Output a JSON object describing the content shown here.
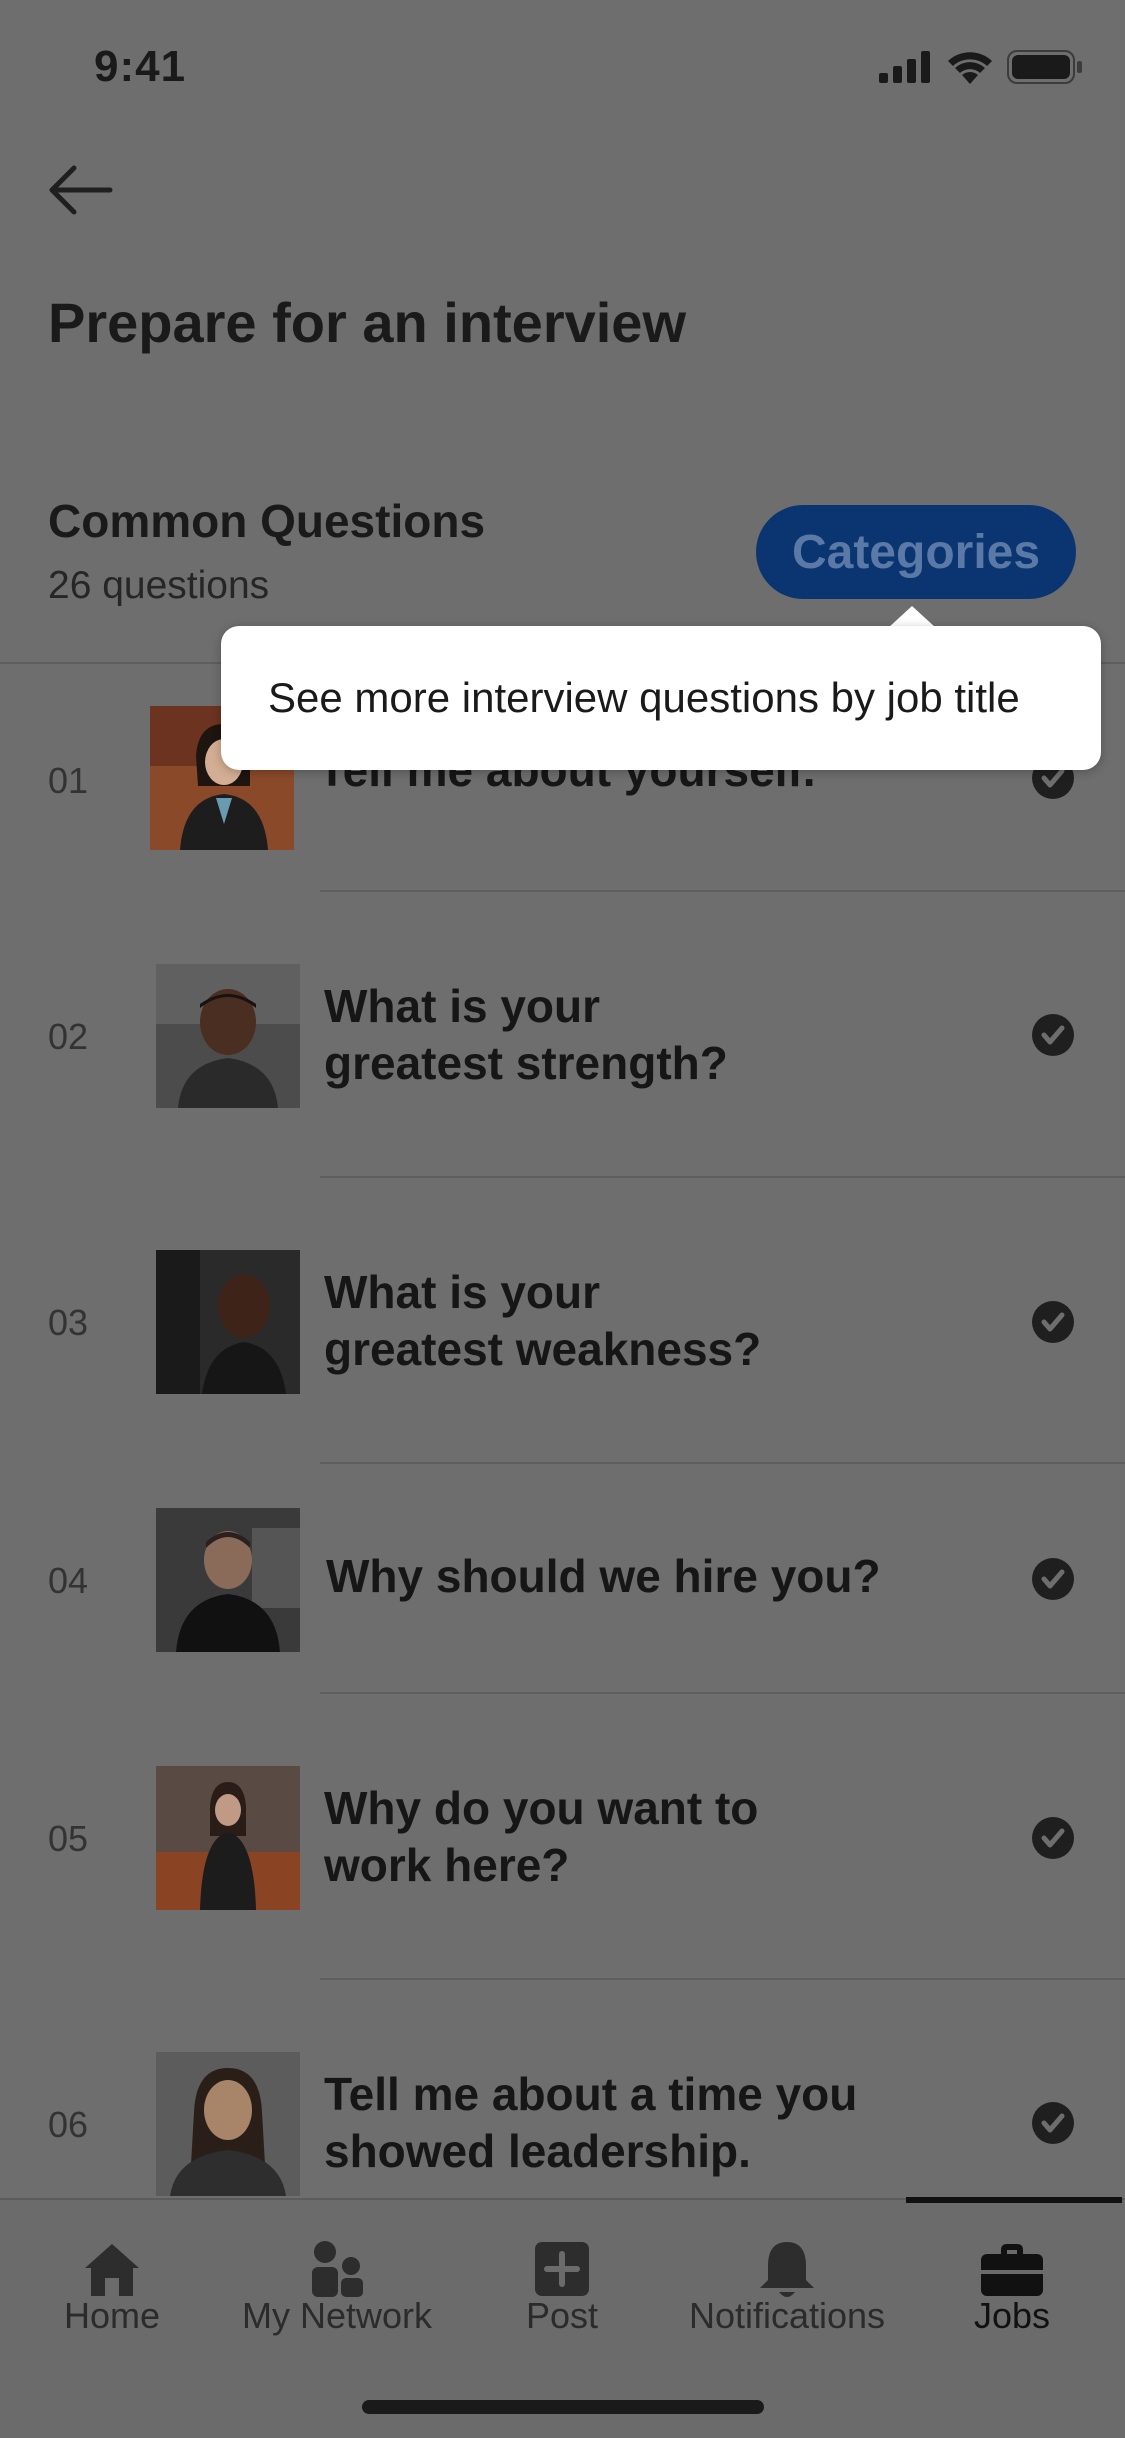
{
  "status_bar": {
    "time": "9:41"
  },
  "header": {
    "title": "Prepare for an interview"
  },
  "section": {
    "title": "Common Questions",
    "subtitle": "26 questions",
    "categories_label": "Categories"
  },
  "tooltip": {
    "text": "See more interview questions by job title"
  },
  "questions": [
    {
      "number": "01",
      "line1": "Tell me about yourself.",
      "line2": ""
    },
    {
      "number": "02",
      "line1": "What is your",
      "line2": "greatest strength?"
    },
    {
      "number": "03",
      "line1": "What is your",
      "line2": "greatest weakness?"
    },
    {
      "number": "04",
      "line1": "Why should we hire you?",
      "line2": ""
    },
    {
      "number": "05",
      "line1": "Why do you want to",
      "line2": "work here?"
    },
    {
      "number": "06",
      "line1": "Tell me about a time you",
      "line2": "showed leadership."
    }
  ],
  "tabbar": {
    "items": [
      {
        "label": "Home",
        "icon": "home-icon"
      },
      {
        "label": "My Network",
        "icon": "network-icon"
      },
      {
        "label": "Post",
        "icon": "post-icon"
      },
      {
        "label": "Notifications",
        "icon": "bell-icon"
      },
      {
        "label": "Jobs",
        "icon": "briefcase-icon"
      }
    ],
    "active": "Jobs"
  }
}
